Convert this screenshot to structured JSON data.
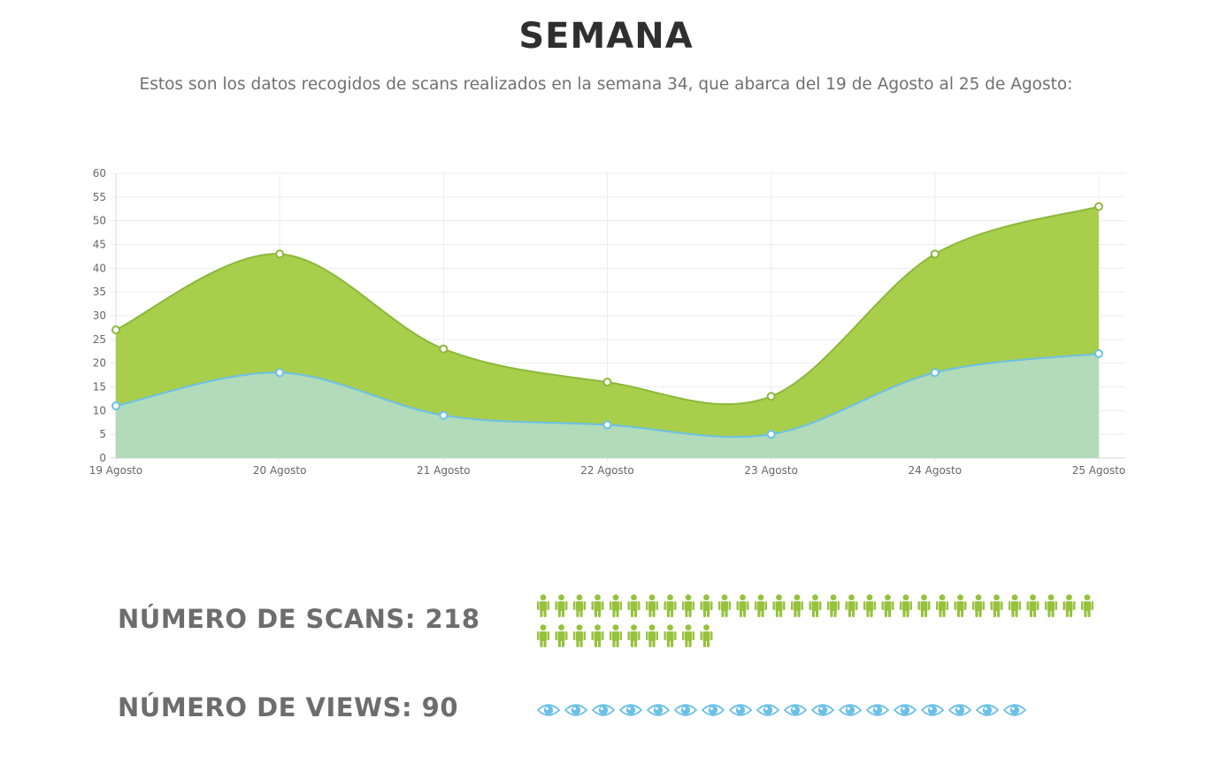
{
  "header": {
    "title": "SEMANA",
    "subtitle": "Estos son los datos recogidos de scans realizados en la semana 34, que abarca del 19 de Agosto al 25 de Agosto:"
  },
  "colors": {
    "scans_fill": "#a8ce4c",
    "scans_stroke": "#8cb83a",
    "views_fill": "#b1dbb9",
    "views_stroke": "#6cc0e8",
    "person_icon": "#96c23c",
    "eye_icon": "#6cc0e8"
  },
  "chart_data": {
    "type": "area",
    "stacked": true,
    "categories": [
      "19 Agosto",
      "20 Agosto",
      "21 Agosto",
      "22 Agosto",
      "23 Agosto",
      "24 Agosto",
      "25 Agosto"
    ],
    "series": [
      {
        "values": [
          11,
          18,
          9,
          7,
          5,
          18,
          22
        ]
      },
      {
        "values": [
          27,
          43,
          23,
          16,
          13,
          43,
          53
        ]
      }
    ],
    "ylim": [
      0,
      60
    ],
    "yticks": [
      0,
      5,
      10,
      15,
      20,
      25,
      30,
      35,
      40,
      45,
      50,
      55,
      60
    ],
    "grid": true
  },
  "stats": {
    "scans_label": "NÚMERO DE SCANS: 218",
    "views_label": "NÚMERO DE VIEWS: 90",
    "scans_icon": "person-icon",
    "scans_icon_count": 41,
    "views_icon": "eye-icon",
    "views_icon_count": 18
  }
}
